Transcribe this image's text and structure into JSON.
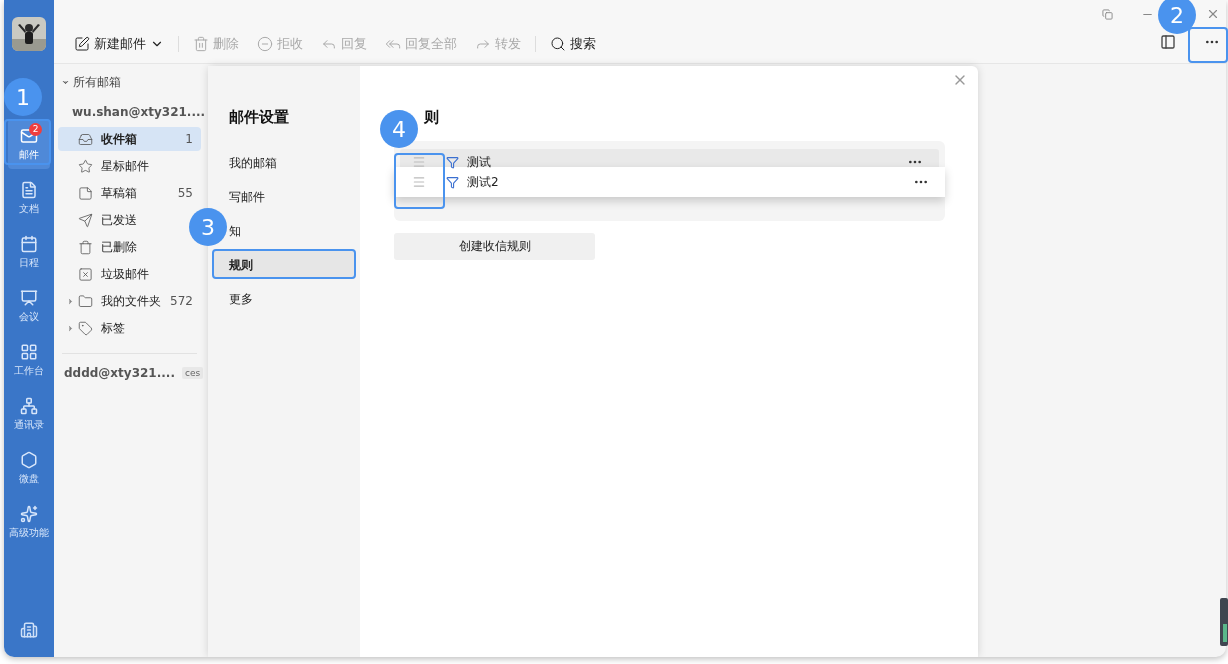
{
  "rail": {
    "items": [
      {
        "label": "邮件",
        "selected": true,
        "badge": "2"
      },
      {
        "label": "文档",
        "selected": false
      },
      {
        "label": "日程",
        "selected": false
      },
      {
        "label": "会议",
        "selected": false
      },
      {
        "label": "工作台",
        "selected": false
      },
      {
        "label": "通讯录",
        "selected": false
      },
      {
        "label": "微盘",
        "selected": false
      },
      {
        "label": "高级功能",
        "selected": false
      }
    ]
  },
  "toolbar": {
    "buttons": [
      {
        "label": "新建邮件",
        "disabled": false,
        "menu": true
      },
      {
        "label": "删除",
        "disabled": true
      },
      {
        "label": "拒收",
        "disabled": true
      },
      {
        "label": "回复",
        "disabled": true
      },
      {
        "label": "回复全部",
        "disabled": true
      },
      {
        "label": "转发",
        "disabled": true
      },
      {
        "label": "搜索",
        "disabled": false
      }
    ]
  },
  "folders": {
    "heading": "所有邮箱",
    "account": "wu.shan@xty321....",
    "items": [
      {
        "label": "收件箱",
        "count": "1",
        "selected": true
      },
      {
        "label": "星标邮件",
        "selected": false
      },
      {
        "label": "草稿箱",
        "count": "55",
        "selected": false
      },
      {
        "label": "已发送",
        "selected": false
      },
      {
        "label": "已删除",
        "selected": false
      },
      {
        "label": "垃圾邮件",
        "selected": false
      },
      {
        "label": "我的文件夹",
        "count": "572",
        "selected": false,
        "expandable": true
      },
      {
        "label": "标签",
        "selected": false,
        "expandable": true
      }
    ],
    "other_account": {
      "label": "dddd@xty321....",
      "tag": "ces"
    }
  },
  "dialog": {
    "title": "邮件设置",
    "nav": [
      {
        "label": "我的邮箱",
        "selected": false
      },
      {
        "label": "写邮件",
        "selected": false
      },
      {
        "label": "知",
        "selected": false
      },
      {
        "label": "规则",
        "selected": true
      },
      {
        "label": "更多",
        "selected": false
      }
    ],
    "heading": "则",
    "rules": [
      {
        "name": "测试",
        "dragging": false
      },
      {
        "name": "测试2",
        "dragging": true
      }
    ],
    "create_button": "创建收信规则"
  },
  "callouts": [
    {
      "number": "1"
    },
    {
      "number": "2"
    },
    {
      "number": "3"
    },
    {
      "number": "4"
    }
  ]
}
